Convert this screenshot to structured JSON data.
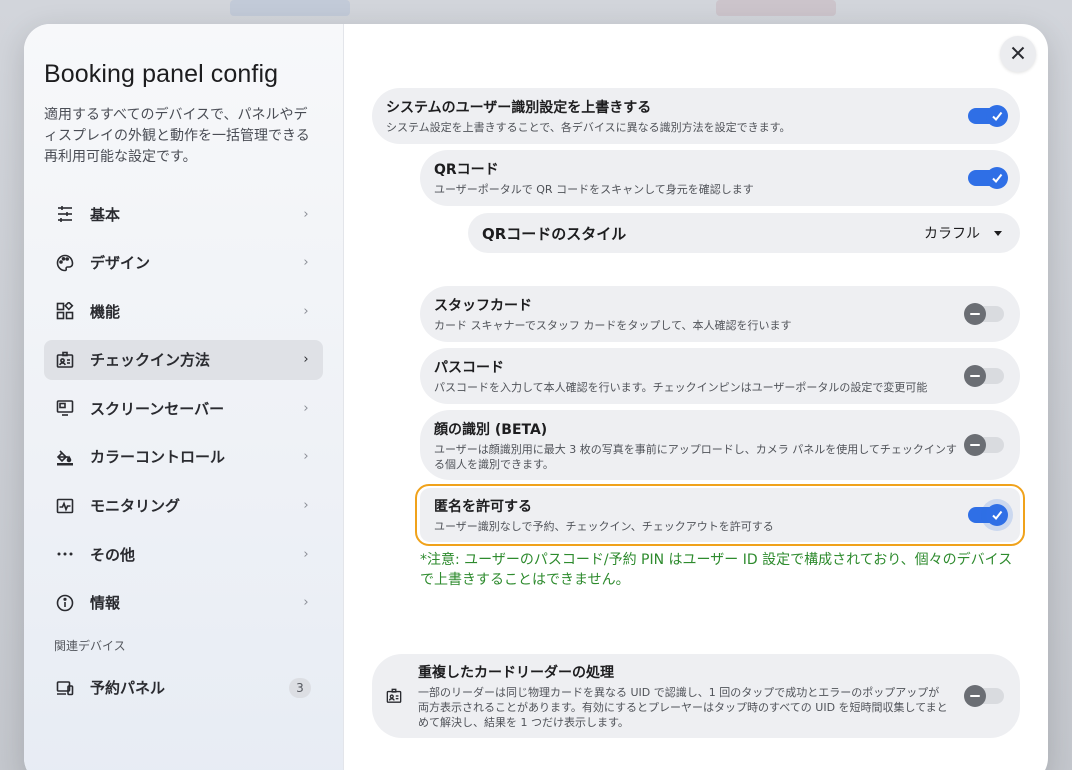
{
  "sidebar": {
    "title": "Booking panel config",
    "description": "適用するすべてのデバイスで、パネルやディスプレイの外観と動作を一括管理できる再利用可能な設定です。",
    "items": [
      {
        "label": "基本",
        "icon": "sliders-icon"
      },
      {
        "label": "デザイン",
        "icon": "palette-icon"
      },
      {
        "label": "機能",
        "icon": "widgets-icon"
      },
      {
        "label": "チェックイン方法",
        "icon": "id-badge-icon",
        "active": true
      },
      {
        "label": "スクリーンセーバー",
        "icon": "monitor-icon"
      },
      {
        "label": "カラーコントロール",
        "icon": "paint-bucket-icon"
      },
      {
        "label": "モニタリング",
        "icon": "monitoring-icon"
      },
      {
        "label": "その他",
        "icon": "more-dots-icon"
      },
      {
        "label": "情報",
        "icon": "info-icon"
      }
    ],
    "related_section": "関連デバイス",
    "related_items": [
      {
        "label": "予約パネル",
        "icon": "devices-icon",
        "count": "3"
      }
    ]
  },
  "main": {
    "settings": {
      "override": {
        "title": "システムのユーザー識別設定を上書きする",
        "subtitle": "システム設定を上書きすることで、各デバイスに異なる識別方法を設定できます。",
        "enabled": true
      },
      "qr": {
        "title": "QRコード",
        "subtitle": "ユーザーポータルで QR コードをスキャンして身元を確認します",
        "enabled": true
      },
      "qr_style": {
        "label": "QRコードのスタイル",
        "value": "カラフル"
      },
      "staff_card": {
        "title": "スタッフカード",
        "subtitle": "カード スキャナーでスタッフ カードをタップして、本人確認を行います",
        "enabled": false
      },
      "passcode": {
        "title": "パスコード",
        "subtitle": "パスコードを入力して本人確認を行います。チェックインピンはユーザーポータルの設定で変更可能",
        "enabled": false
      },
      "face": {
        "title": "顔の識別 (BETA)",
        "subtitle": "ユーザーは顔識別用に最大 3 枚の写真を事前にアップロードし、カメラ パネルを使用してチェックインする個人を識別できます。",
        "enabled": false
      },
      "anonymous": {
        "title": "匿名を許可する",
        "subtitle": "ユーザー識別なしで予約、チェックイン、チェックアウトを許可する",
        "enabled": true
      },
      "note": "*注意: ユーザーのパスコード/予約 PIN はユーザー ID 設定で構成されており、個々のデバイスで上書きすることはできません。",
      "duplicate_reader": {
        "title": "重複したカードリーダーの処理",
        "subtitle": "一部のリーダーは同じ物理カードを異なる UID で認識し、1 回のタップで成功とエラーのポップアップが両方表示されることがあります。有効にするとプレーヤーはタップ時のすべての UID を短時間収集してまとめて解決し、結果を 1 つだけ表示します。",
        "enabled": false
      }
    }
  },
  "colors": {
    "accent": "#2f6fe6",
    "focus": "#f0a21b",
    "note": "#2e8b2e"
  }
}
